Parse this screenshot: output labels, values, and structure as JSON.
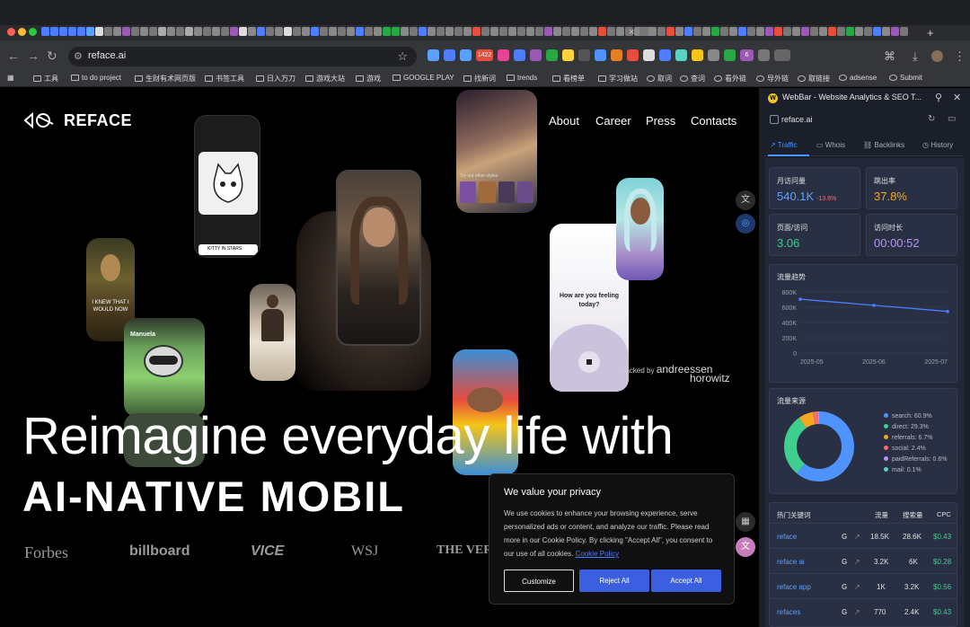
{
  "browser": {
    "url": "reface.ai",
    "tab_close": "×",
    "new_tab": "+",
    "ext_badge_1": "1422",
    "ext_badge_2": "6"
  },
  "bookmarks": [
    {
      "label": "工具"
    },
    {
      "label": "to do project"
    },
    {
      "label": "生财有术网页版"
    },
    {
      "label": "书签工具"
    },
    {
      "label": "日入万刀"
    },
    {
      "label": "游戏大站"
    },
    {
      "label": "游戏"
    },
    {
      "label": "GOOGLE PLAY"
    },
    {
      "label": "找新词"
    },
    {
      "label": "trends"
    },
    {
      "label": "看榜单"
    },
    {
      "label": "学习做站"
    },
    {
      "label": "取词"
    },
    {
      "label": "查词"
    },
    {
      "label": "看外链"
    },
    {
      "label": "导外链"
    },
    {
      "label": "取链接"
    },
    {
      "label": "adsense"
    },
    {
      "label": "Submit"
    }
  ],
  "site": {
    "brand": "REFACE",
    "nav": [
      "About",
      "Career",
      "Press",
      "Contacts"
    ],
    "hero_line1": "Reimagine everyday life with",
    "hero_line2": "AI-NATIVE MOBIL",
    "press_logos": [
      "Forbes",
      "billboard",
      "VICE",
      "WSJ",
      "THE VERG"
    ],
    "backed_by": "backed by",
    "backer_1": "andreessen",
    "backer_2": "horowitz",
    "card_mona": "I KNEW THAT I WOULD NOW",
    "card_manuela": "Manuela",
    "card_kitty": "KITTY IN STARS",
    "card_feeling": "How are you feeling today?",
    "card_styles": "Try out other styles"
  },
  "cookie": {
    "title": "We value your privacy",
    "body": "We use cookies to enhance your browsing experience, serve personalized ads or content, and analyze our traffic. Please read more in our Cookie Policy. By clicking \"Accept All\", you consent to our use of all cookies.",
    "link": "Cookie Policy",
    "customize": "Customize",
    "reject": "Reject All",
    "accept": "Accept All"
  },
  "webbar": {
    "title": "WebBar - Website Analytics & SEO T...",
    "domain": "reface.ai",
    "tabs": [
      "Traffic",
      "Whois",
      "Backlinks",
      "History"
    ],
    "metrics": [
      {
        "label": "月访问量",
        "value": "540.1K",
        "change": "-13.6%",
        "color": "#5aa0ff"
      },
      {
        "label": "跳出率",
        "value": "37.8%",
        "color": "#f5a623"
      },
      {
        "label": "页面/访问",
        "value": "3.06",
        "color": "#3ecf8e"
      },
      {
        "label": "访问时长",
        "value": "00:00:52",
        "color": "#b794f6"
      }
    ],
    "trend_title": "流量趋势",
    "source_title": "流量来源",
    "keywords_title": "热门关键词",
    "keyword_cols": [
      "流量",
      "搜索量",
      "CPC"
    ],
    "keywords": [
      {
        "term": "reface",
        "traffic": "18.5K",
        "volume": "28.6K",
        "cpc": "$0.43"
      },
      {
        "term": "reface ai",
        "traffic": "3.2K",
        "volume": "6K",
        "cpc": "$0.28"
      },
      {
        "term": "reface app",
        "traffic": "1K",
        "volume": "3.2K",
        "cpc": "$0.56"
      },
      {
        "term": "refaces",
        "traffic": "770",
        "volume": "2.4K",
        "cpc": "$0.43"
      }
    ]
  },
  "chart_data": [
    {
      "type": "line",
      "title": "流量趋势",
      "x": [
        "2025-05",
        "2025-06",
        "2025-07"
      ],
      "values": [
        705,
        625,
        545
      ],
      "ylim": [
        0,
        800
      ],
      "y_ticks": [
        "0",
        "200K",
        "400K",
        "600K",
        "800K"
      ],
      "color": "#4e7dff",
      "grid": true
    },
    {
      "type": "pie",
      "title": "流量来源",
      "donut": true,
      "legend_position": "right",
      "slices": [
        {
          "label": "search: 60.9%",
          "value": 60.9,
          "color": "#4e93ff"
        },
        {
          "label": "direct: 29.3%",
          "value": 29.3,
          "color": "#3ecf8e"
        },
        {
          "label": "referrals: 6.7%",
          "value": 6.7,
          "color": "#f5a623"
        },
        {
          "label": "social: 2.4%",
          "value": 2.4,
          "color": "#ff6b6b"
        },
        {
          "label": "paidReferrals: 0.6%",
          "value": 0.6,
          "color": "#b794f6"
        },
        {
          "label": "mail: 0.1%",
          "value": 0.1,
          "color": "#5ad1c5"
        }
      ]
    }
  ]
}
